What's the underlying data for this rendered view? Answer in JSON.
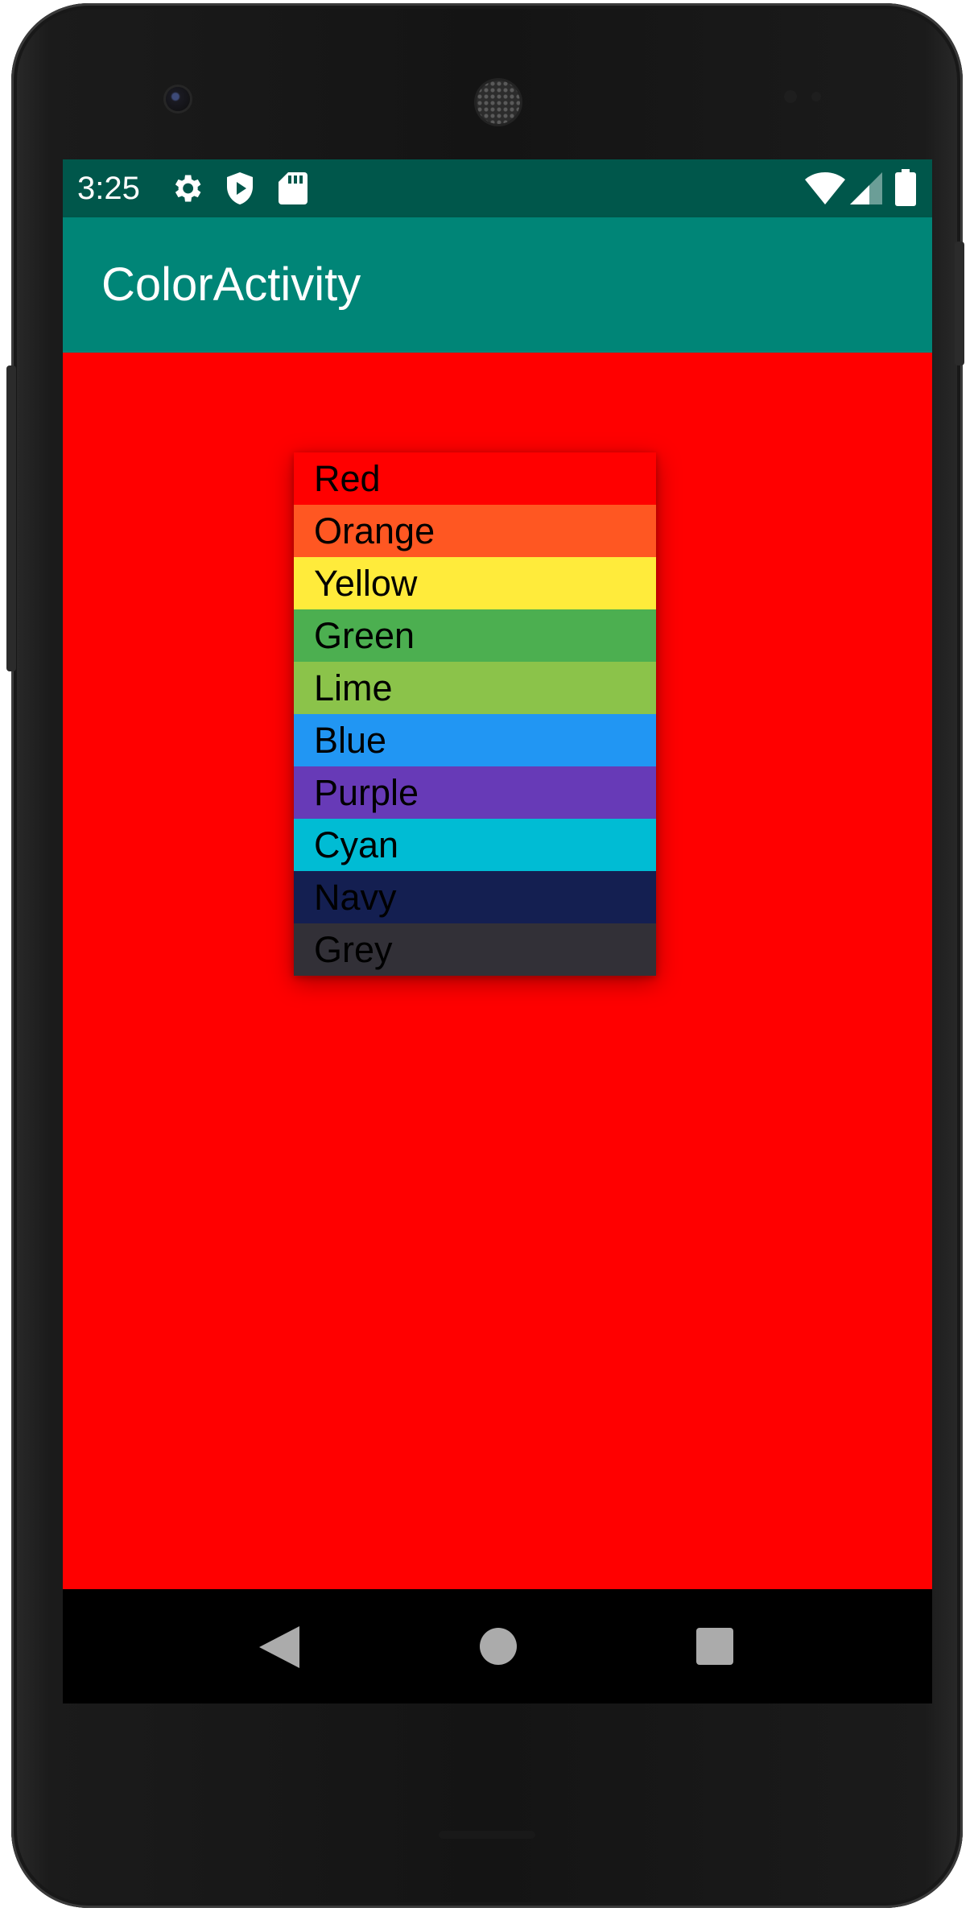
{
  "status_bar": {
    "time": "3:25",
    "icons": [
      "gear-icon",
      "shield-play-icon",
      "sd-card-icon",
      "wifi-icon",
      "signal-icon",
      "battery-icon"
    ],
    "color": "#00574b"
  },
  "app_bar": {
    "title": "ColorActivity",
    "color": "#008577"
  },
  "content": {
    "background_color": "#ff0000",
    "color_menu": [
      {
        "label": "Red",
        "color": "#ff0000"
      },
      {
        "label": "Orange",
        "color": "#ff5722"
      },
      {
        "label": "Yellow",
        "color": "#ffeb3b"
      },
      {
        "label": "Green",
        "color": "#4caf50"
      },
      {
        "label": "Lime",
        "color": "#8bc34a"
      },
      {
        "label": "Blue",
        "color": "#2196f3"
      },
      {
        "label": "Purple",
        "color": "#673ab7"
      },
      {
        "label": "Cyan",
        "color": "#00bcd4"
      },
      {
        "label": "Navy",
        "color": "#141f51"
      },
      {
        "label": "Grey",
        "color": "#323037"
      }
    ]
  },
  "nav_bar": {
    "buttons": [
      "back-icon",
      "home-icon",
      "recents-icon"
    ]
  }
}
